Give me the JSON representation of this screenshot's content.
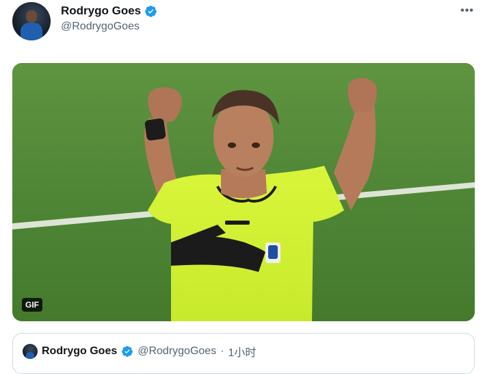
{
  "tweet": {
    "author": {
      "display_name": "Rodrygo Goes",
      "handle": "@RodrygoGoes",
      "verified": true
    },
    "more_label": "•••",
    "media": {
      "type": "gif",
      "badge": "GIF"
    },
    "quoted": {
      "display_name": "Rodrygo Goes",
      "handle": "@RodrygoGoes",
      "separator": "·",
      "time": "1小时"
    }
  },
  "colors": {
    "verified": "#1d9bf0",
    "text_primary": "#0f1419",
    "text_secondary": "#536471",
    "border": "#cfd9de"
  }
}
